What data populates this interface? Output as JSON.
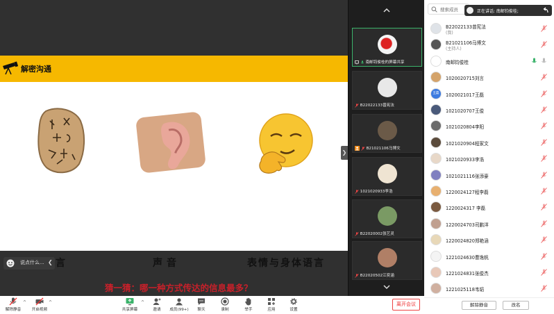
{
  "slide": {
    "title": "解密沟通",
    "captions": [
      "语言",
      "声音",
      "表情与身体语言"
    ],
    "question": "猜一猜：哪一种方式传达的信息最多？"
  },
  "chat": {
    "placeholder": "说点什么..."
  },
  "video_strip": {
    "tiles": [
      {
        "name": "南邮钧俊桂的屏幕共享",
        "active": true
      },
      {
        "name": "B22022133曾宪法",
        "active": false
      },
      {
        "name": "B21021106马博文",
        "active": false
      },
      {
        "name": "1021020933李浩",
        "active": false
      },
      {
        "name": "B22020002张艺灵",
        "active": false
      },
      {
        "name": "B22020502江奕涵",
        "active": false
      }
    ]
  },
  "panel": {
    "search_placeholder": "搜索成员",
    "speaking": "正在讲话: 南邮钧俊桂;",
    "participants": [
      {
        "name": "B22022133曾宪法",
        "role": "(我)",
        "avatar_text": ""
      },
      {
        "name": "B21021106马博文",
        "role": "(主持人)",
        "avatar_text": ""
      },
      {
        "name": "南邮钧俊桂",
        "role": "",
        "avatar_text": ""
      },
      {
        "name": "1020020715刘言",
        "role": "",
        "avatar_text": ""
      },
      {
        "name": "1020021017王磊",
        "role": "",
        "avatar_text": "王磊"
      },
      {
        "name": "1021020707王俊",
        "role": "",
        "avatar_text": ""
      },
      {
        "name": "1021020804李阳",
        "role": "",
        "avatar_text": ""
      },
      {
        "name": "1021020904程家文",
        "role": "",
        "avatar_text": ""
      },
      {
        "name": "1021020933李浩",
        "role": "",
        "avatar_text": ""
      },
      {
        "name": "1021021116张添豪",
        "role": "",
        "avatar_text": ""
      },
      {
        "name": "1220024127程李磊",
        "role": "",
        "avatar_text": ""
      },
      {
        "name": "1220024317 李磊",
        "role": "",
        "avatar_text": ""
      },
      {
        "name": "1220024703司鹏洋",
        "role": "",
        "avatar_text": ""
      },
      {
        "name": "1220024820郑艳涵",
        "role": "",
        "avatar_text": ""
      },
      {
        "name": "1221024630曹逸帆",
        "role": "",
        "avatar_text": ""
      },
      {
        "name": "1221024831张俊杰",
        "role": "",
        "avatar_text": ""
      },
      {
        "name": "1221025118韦韬",
        "role": "",
        "avatar_text": ""
      }
    ],
    "unmute_all": "解除静音",
    "rename": "改名"
  },
  "toolbar": {
    "unmute": "解除静音",
    "start_video": "开启视频",
    "share_screen": "共享屏幕",
    "invite": "邀请",
    "members": "成员(99+)",
    "chat": "聊天",
    "record": "录制",
    "raise_hand": "举手",
    "apps": "应用",
    "settings": "设置",
    "leave": "离开会议"
  },
  "colors": {
    "slide_bar": "#f6b800",
    "question_red": "#c8202a",
    "active_tile": "#3bb36b",
    "leave_red": "#e33333"
  }
}
